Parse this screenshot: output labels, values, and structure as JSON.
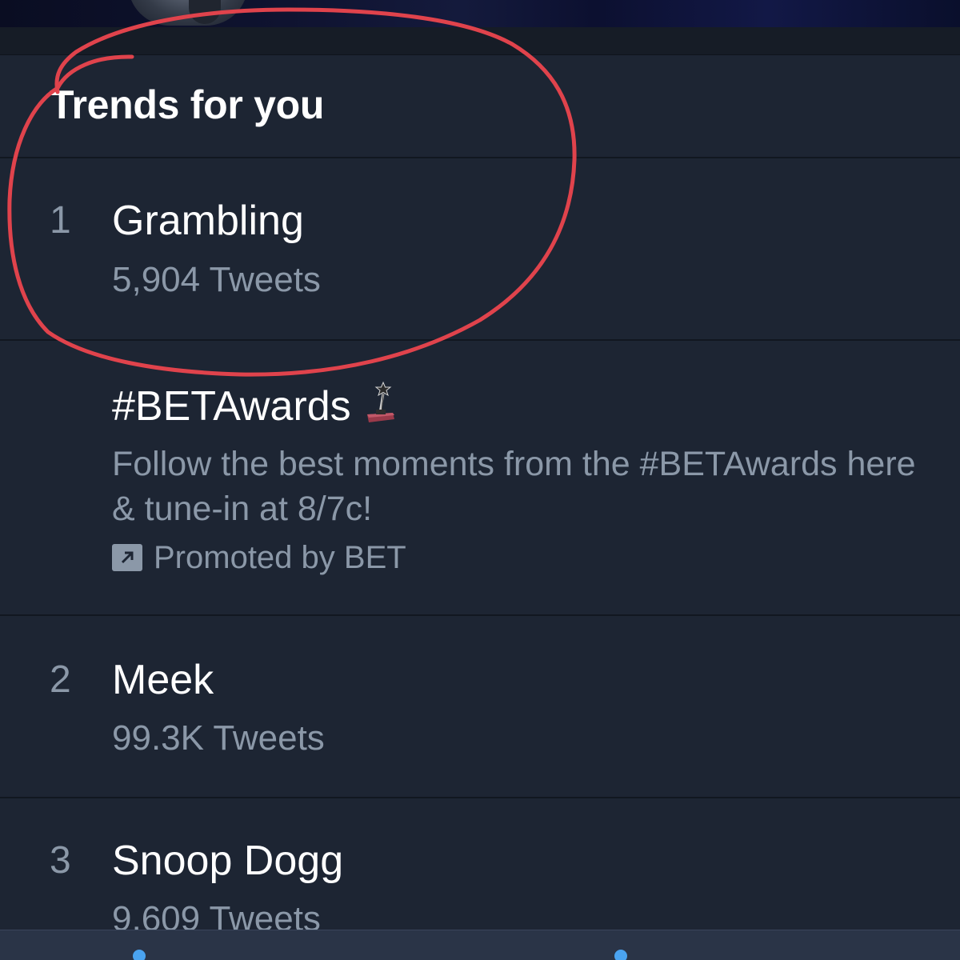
{
  "header": {
    "title": "Trends for you"
  },
  "trends": [
    {
      "rank": "1",
      "name": "Grambling",
      "meta": "5,904 Tweets"
    },
    {
      "rank": "2",
      "name": "Meek",
      "meta": "99.3K Tweets"
    },
    {
      "rank": "3",
      "name": "Snoop Dogg",
      "meta": "9,609 Tweets"
    }
  ],
  "promoted": {
    "name": "#BETAwards",
    "description": "Follow the best moments from the #BETAwards here & tune-in at 8/7c!",
    "promoted_by": "Promoted by BET",
    "icon": "award-trophy-icon"
  },
  "colors": {
    "background": "#1d2533",
    "primary_text": "#ffffff",
    "secondary_text": "#8b98a8",
    "divider": "#111720",
    "annotation": "#e0434c",
    "accent": "#4aa3f0"
  }
}
